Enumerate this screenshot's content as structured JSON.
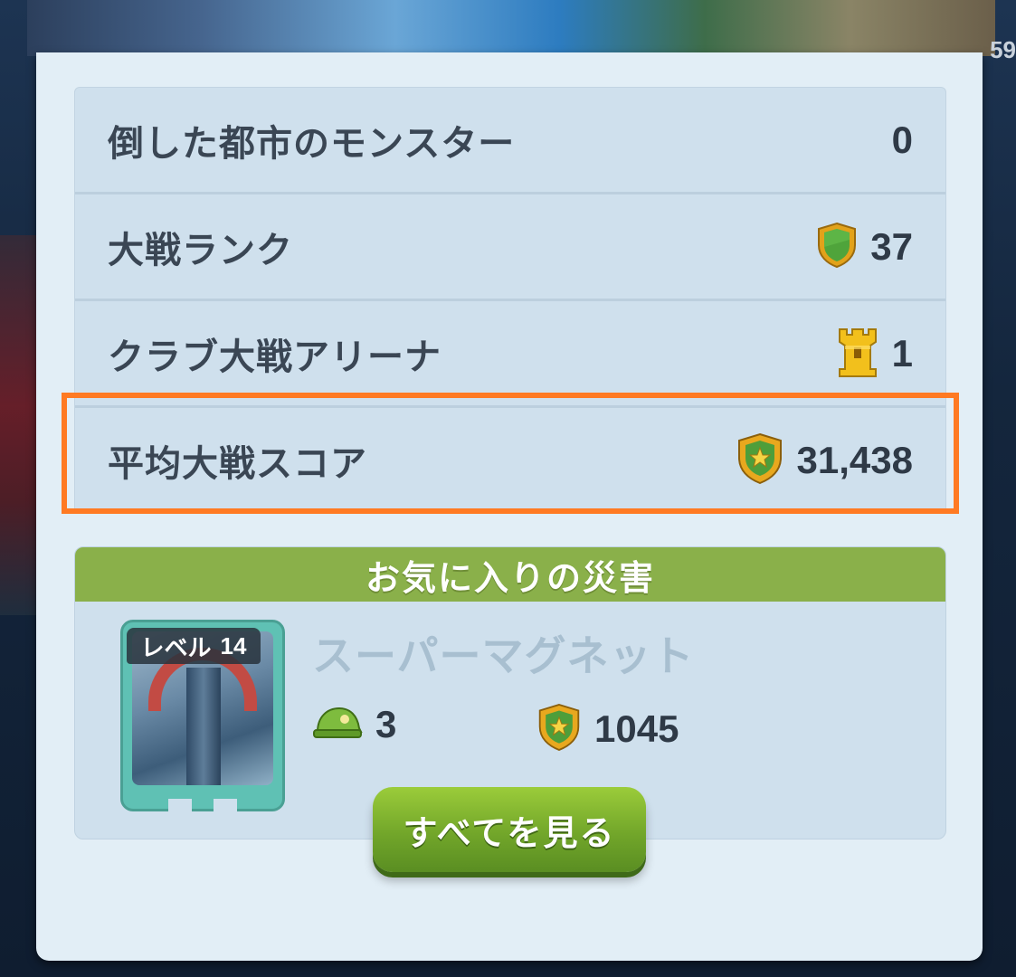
{
  "corner_number": "59",
  "stats": [
    {
      "label": "倒した都市のモンスター",
      "value": "0",
      "icon": "none"
    },
    {
      "label": "大戦ランク",
      "value": "37",
      "icon": "green-shield-icon"
    },
    {
      "label": "クラブ大戦アリーナ",
      "value": "1",
      "icon": "castle-tower-icon"
    },
    {
      "label": "平均大戦スコア",
      "value": "31,438",
      "icon": "star-shield-icon"
    }
  ],
  "favorite": {
    "header": "お気に入りの災害",
    "level_label": "レベル",
    "level_value": "14",
    "name": "スーパーマグネット",
    "helmet_value": "3",
    "score_value": "1045",
    "button_label": "すべてを見る"
  },
  "colors": {
    "highlight": "#ff7a23",
    "header_green": "#8ab04a",
    "button_green": "#72a62a",
    "panel_bg": "#e2eef6",
    "row_bg": "#cfe0ed"
  }
}
